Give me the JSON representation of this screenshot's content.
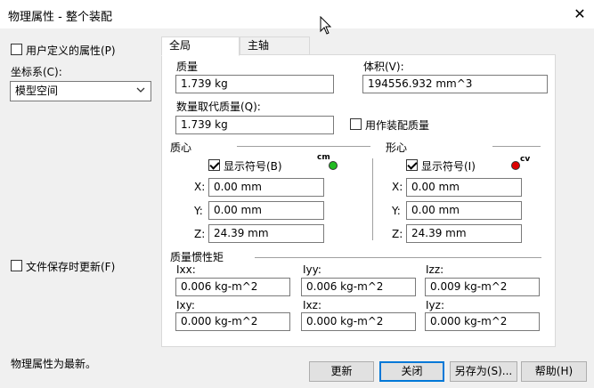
{
  "window": {
    "title": "物理属性 - 整个装配",
    "close_glyph": "✕"
  },
  "left": {
    "user_props_label": "用户定义的属性(P)",
    "coord_label": "坐标系(C):",
    "coord_value": "模型空间",
    "update_on_save_label": "文件保存时更新(F)"
  },
  "tabs": [
    {
      "label": "全局"
    },
    {
      "label": "主轴"
    }
  ],
  "general": {
    "mass_label": "质量",
    "mass_value": "1.739 kg",
    "volume_label": "体积(V):",
    "volume_value": "194556.932 mm^3",
    "override_mass_label": "数量取代质量(Q):",
    "override_mass_value": "1.739 kg",
    "assembly_mass_label": "用作装配质量"
  },
  "center_of_mass": {
    "label": "质心",
    "show_symbol_label": "显示符号(B)",
    "symbol_text": "cm",
    "symbol_color": "#22bb22",
    "x_label": "X:",
    "x_value": "0.00 mm",
    "y_label": "Y:",
    "y_value": "0.00 mm",
    "z_label": "Z:",
    "z_value": "24.39 mm"
  },
  "centroid": {
    "label": "形心",
    "show_symbol_label": "显示符号(I)",
    "symbol_text": "cv",
    "symbol_color": "#dd0000",
    "x_label": "X:",
    "x_value": "0.00 mm",
    "y_label": "Y:",
    "y_value": "0.00 mm",
    "z_label": "Z:",
    "z_value": "24.39 mm"
  },
  "inertia": {
    "label": "质量惯性矩",
    "ixx_label": "Ixx:",
    "ixx_value": "0.006 kg-m^2",
    "iyy_label": "Iyy:",
    "iyy_value": "0.006 kg-m^2",
    "izz_label": "Izz:",
    "izz_value": "0.009 kg-m^2",
    "ixy_label": "Ixy:",
    "ixy_value": "0.000 kg-m^2",
    "ixz_label": "Ixz:",
    "ixz_value": "0.000 kg-m^2",
    "iyz_label": "Iyz:",
    "iyz_value": "0.000 kg-m^2"
  },
  "status": {
    "text": "物理属性为最新。"
  },
  "buttons": {
    "update": "更新",
    "close": "关闭",
    "save_as": "另存为(S)...",
    "help": "帮助(H)"
  },
  "colors": {
    "accent": "#0078d7"
  }
}
